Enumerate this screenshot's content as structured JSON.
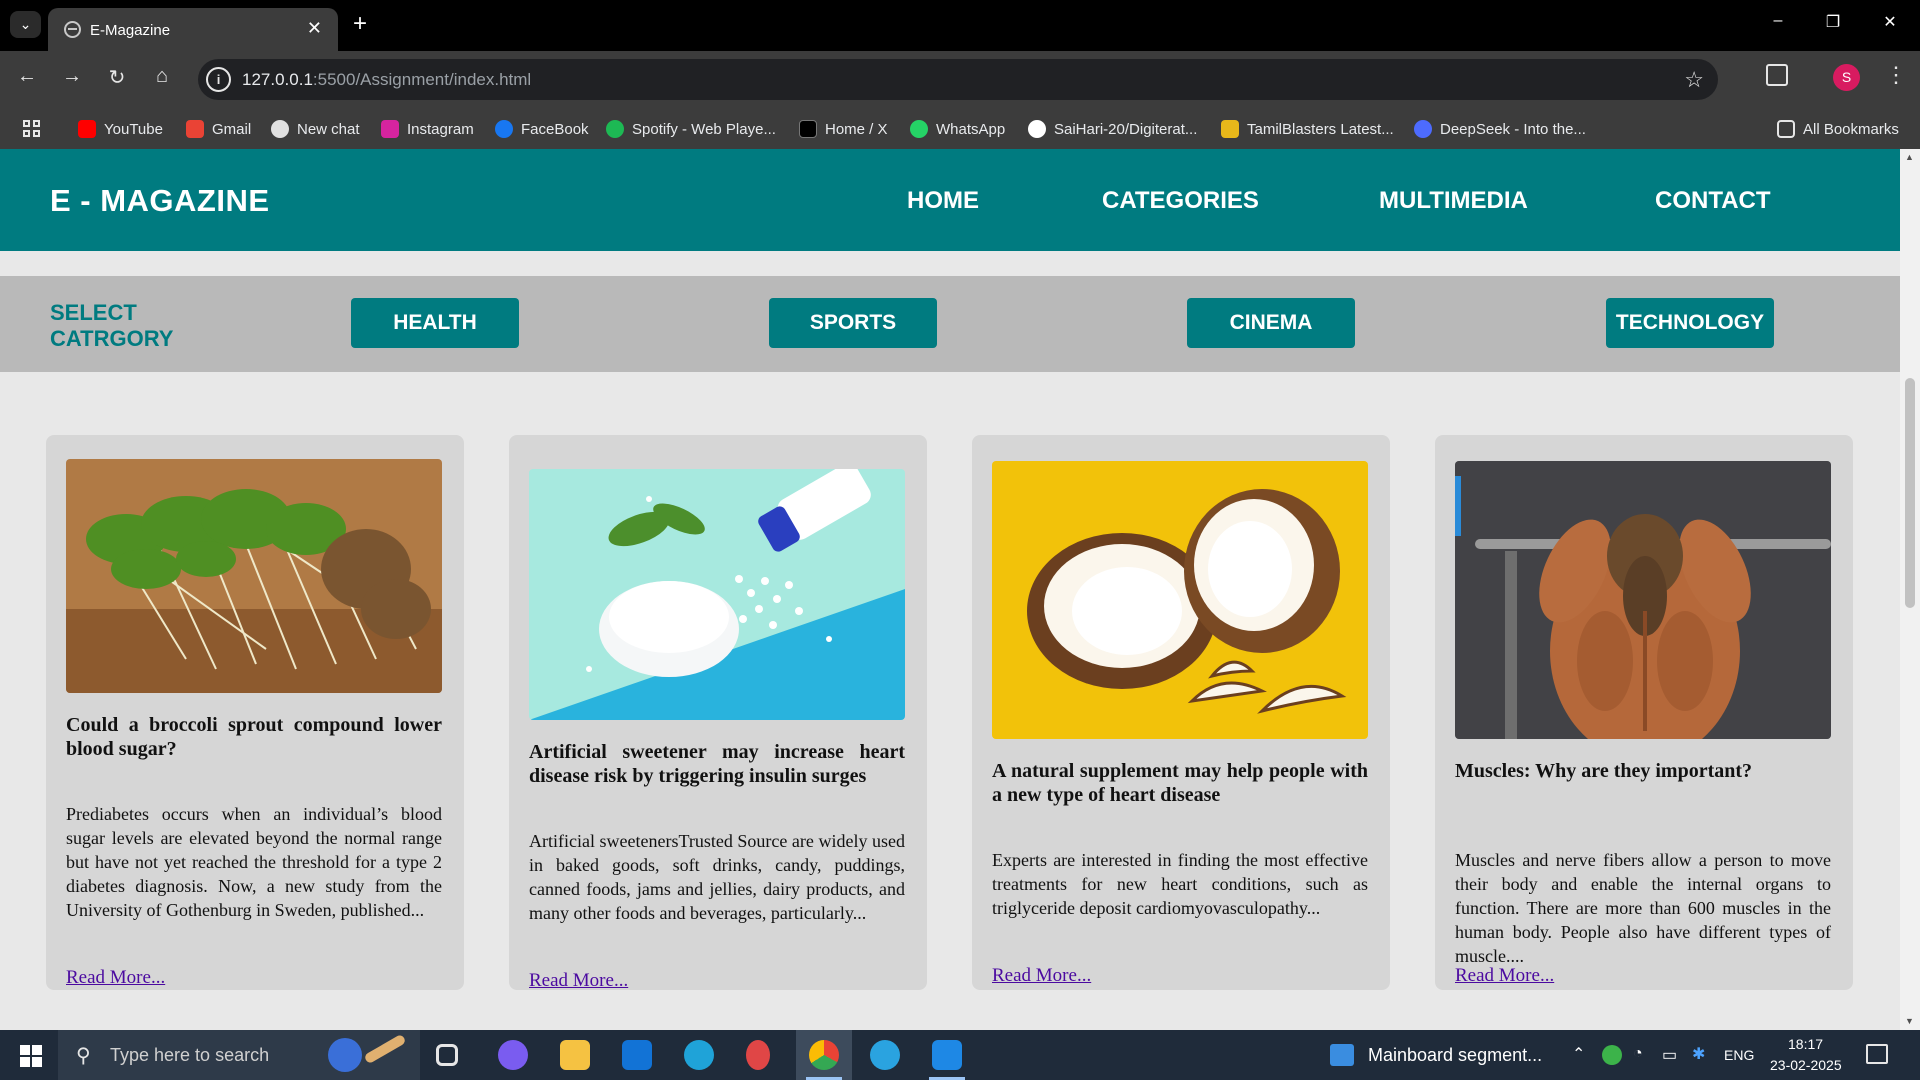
{
  "browser": {
    "tab_title": "E-Magazine",
    "url_host": "127.0.0.1",
    "url_rest": ":5500/Assignment/index.html",
    "bookmarks": [
      {
        "label": "YouTube",
        "color": "#ff0000"
      },
      {
        "label": "Gmail",
        "color": "#ea4335"
      },
      {
        "label": "New chat",
        "color": "#e0e0e0"
      },
      {
        "label": "Instagram",
        "color": "#d6249f"
      },
      {
        "label": "FaceBook",
        "color": "#1877f2"
      },
      {
        "label": "Spotify - Web Playe...",
        "color": "#1db954"
      },
      {
        "label": "Home / X",
        "color": "#000000"
      },
      {
        "label": "WhatsApp",
        "color": "#25d366"
      },
      {
        "label": "SaiHari-20/Digiterat...",
        "color": "#ffffff"
      },
      {
        "label": "TamilBlasters Latest...",
        "color": "#e8b81a"
      },
      {
        "label": "DeepSeek - Into the...",
        "color": "#4d6bfe"
      }
    ],
    "all_bookmarks": "All Bookmarks",
    "profile_initial": "S"
  },
  "site": {
    "logo": "E - MAGAZINE",
    "nav": [
      "HOME",
      "CATEGORIES",
      "MULTIMEDIA",
      "CONTACT"
    ],
    "category_label_line1": "SELECT",
    "category_label_line2": "CATRGORY",
    "categories": [
      "HEALTH",
      "SPORTS",
      "CINEMA",
      "TECHNOLOGY"
    ],
    "accent_color": "#007b80",
    "read_more": "Read More...",
    "articles": [
      {
        "image": "broccoli-sprouts-image",
        "title": "Could a broccoli sprout compound lower blood sugar?",
        "body": "Prediabetes occurs when an individual’s blood sugar levels are elevated beyond the normal range but have not yet reached the threshold for a type 2 diabetes diagnosis. Now, a new study from the University of Gothenburg in Sweden, published..."
      },
      {
        "image": "artificial-sweetener-image",
        "title": "Artificial sweetener may increase heart disease risk by triggering insulin surges",
        "body": "Artificial sweetenersTrusted Source are widely used in baked goods, soft drinks, candy, puddings, canned foods, jams and jellies, dairy products, and many other foods and beverages, particularly..."
      },
      {
        "image": "coconut-image",
        "title": "A natural supplement may help people with a new type of heart disease",
        "body": "Experts are interested in finding the most effective treatments for new heart conditions, such as triglyceride deposit cardiomyovasculopathy..."
      },
      {
        "image": "muscular-man-image",
        "title": "Muscles: Why are they important?",
        "body": "Muscles and nerve fibers allow a person to move their body and enable the internal organs to function. There are more than 600 muscles in the human body. People also have different types of muscle...."
      }
    ]
  },
  "taskbar": {
    "search_placeholder": "Type here to search",
    "notification": "Mainboard segment...",
    "language": "ENG",
    "time": "18:17",
    "date": "23-02-2025"
  }
}
